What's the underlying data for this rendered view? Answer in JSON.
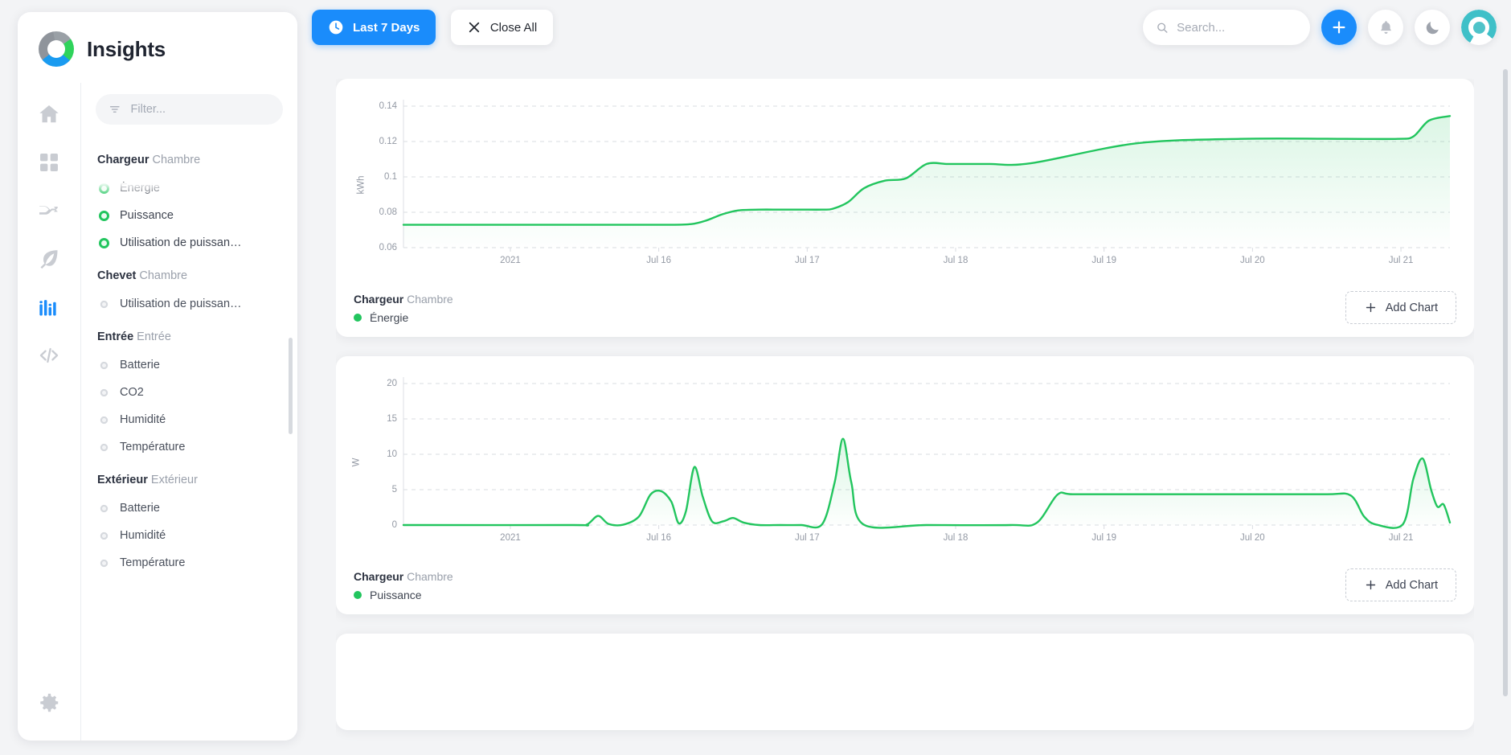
{
  "app": {
    "title": "Insights"
  },
  "sidebar": {
    "filter": {
      "placeholder": "Filter...",
      "value": ""
    },
    "rail": [
      {
        "name": "home-icon",
        "active": false
      },
      {
        "name": "dashboard-grid-icon",
        "active": false
      },
      {
        "name": "automations-icon",
        "active": false
      },
      {
        "name": "energy-leaf-icon",
        "active": false
      },
      {
        "name": "insights-bars-icon",
        "active": true
      },
      {
        "name": "developer-code-icon",
        "active": false
      },
      {
        "name": "settings-gear-icon",
        "active": false
      }
    ],
    "groups": [
      {
        "device": "Chargeur",
        "area": "Chambre",
        "entities": [
          {
            "label": "Énergie",
            "selected": true
          },
          {
            "label": "Puissance",
            "selected": true
          },
          {
            "label": "Utilisation de puissan…",
            "selected": true
          }
        ]
      },
      {
        "device": "Chevet",
        "area": "Chambre",
        "entities": [
          {
            "label": "Utilisation de puissan…",
            "selected": false
          }
        ]
      },
      {
        "device": "Entrée",
        "area": "Entrée",
        "entities": [
          {
            "label": "Batterie",
            "selected": false
          },
          {
            "label": "CO2",
            "selected": false
          },
          {
            "label": "Humidité",
            "selected": false
          },
          {
            "label": "Température",
            "selected": false
          }
        ]
      },
      {
        "device": "Extérieur",
        "area": "Extérieur",
        "entities": [
          {
            "label": "Batterie",
            "selected": false
          },
          {
            "label": "Humidité",
            "selected": false
          },
          {
            "label": "Température",
            "selected": false
          }
        ]
      }
    ]
  },
  "toolbar": {
    "range_label": "Last 7 Days",
    "range_icon": "clock-icon",
    "close_all_label": "Close All",
    "close_all_icon": "close-x-icon",
    "search_placeholder": "Search...",
    "search_value": "",
    "add_icon": "plus-icon",
    "notifications_icon": "bell-icon",
    "theme_icon": "moon-icon",
    "avatar_icon": "user-avatar",
    "accent_color": "#1a8cfb"
  },
  "cards": [
    {
      "footer_device": "Chargeur",
      "footer_area": "Chambre",
      "series_label": "Énergie",
      "add_chart_label": "Add Chart",
      "series_color": "#22c55e"
    },
    {
      "footer_device": "Chargeur",
      "footer_area": "Chambre",
      "series_label": "Puissance",
      "add_chart_label": "Add Chart",
      "series_color": "#22c55e"
    }
  ],
  "chart_data": [
    {
      "type": "area",
      "title": "",
      "xlabel": "",
      "ylabel": "kWh",
      "yticks": [
        "0.06",
        "0.08",
        "0.1",
        "0.12",
        "0.14"
      ],
      "ylim": [
        0.055,
        0.148
      ],
      "xticks": [
        "2021",
        "Jul 16",
        "Jul 17",
        "Jul 18",
        "Jul 19",
        "Jul 20",
        "Jul 21"
      ],
      "grid": true,
      "legend": "bottom-left",
      "series": [
        {
          "name": "Énergie",
          "color": "#22c55e",
          "x": [
            0,
            10,
            20,
            25,
            27.5,
            29,
            30.5,
            32,
            34,
            36,
            38,
            40,
            41,
            42.5,
            44,
            46,
            48,
            50,
            52,
            54,
            56,
            60,
            70,
            80,
            90,
            95,
            96.5,
            98,
            100
          ],
          "values": [
            0.07,
            0.07,
            0.07,
            0.07,
            0.0705,
            0.073,
            0.077,
            0.0795,
            0.08,
            0.08,
            0.08,
            0.08,
            0.0805,
            0.085,
            0.094,
            0.099,
            0.1005,
            0.11,
            0.11,
            0.11,
            0.11,
            0.1105,
            0.1235,
            0.1265,
            0.1265,
            0.1265,
            0.128,
            0.1385,
            0.1415
          ]
        }
      ]
    },
    {
      "type": "area",
      "title": "",
      "xlabel": "",
      "ylabel": "W",
      "yticks": [
        "0",
        "5",
        "10",
        "15",
        "20"
      ],
      "ylim": [
        0,
        20
      ],
      "xticks": [
        "2021",
        "Jul 16",
        "Jul 17",
        "Jul 18",
        "Jul 19",
        "Jul 20",
        "Jul 21"
      ],
      "grid": true,
      "legend": "bottom-left",
      "series": [
        {
          "name": "Puissance",
          "color": "#22c55e",
          "peaks_w": [
            1.3,
            4.8,
            8.2,
            1.0,
            12.2,
            4.3,
            9.4,
            1.8
          ],
          "x": [
            0,
            16,
            17.5,
            18.6,
            19.6,
            21,
            22.5,
            23.6,
            24.6,
            25.6,
            26.3,
            27,
            27.8,
            28.6,
            29.5,
            30.6,
            31.5,
            32.5,
            34,
            36,
            38,
            40,
            41.2,
            42,
            42.8,
            44,
            50,
            58,
            60.5,
            62.5,
            64,
            70,
            80,
            88,
            90.5,
            91.8,
            93,
            95.5,
            96.5,
            97.4,
            98.2,
            98.8,
            99.4,
            100
          ],
          "values": [
            0,
            0,
            0.05,
            1.3,
            0.15,
            0.05,
            1.2,
            4.3,
            4.8,
            3.3,
            0.25,
            2.0,
            8.2,
            4.0,
            0.5,
            0.55,
            1.0,
            0.35,
            0,
            0,
            0,
            0.1,
            6.0,
            12.2,
            6.0,
            0.05,
            0,
            0,
            0.3,
            4.3,
            4.35,
            4.35,
            4.35,
            4.35,
            4.2,
            1.2,
            0.05,
            0.1,
            6.5,
            9.4,
            5.0,
            2.6,
            2.9,
            0.35
          ]
        }
      ]
    }
  ]
}
